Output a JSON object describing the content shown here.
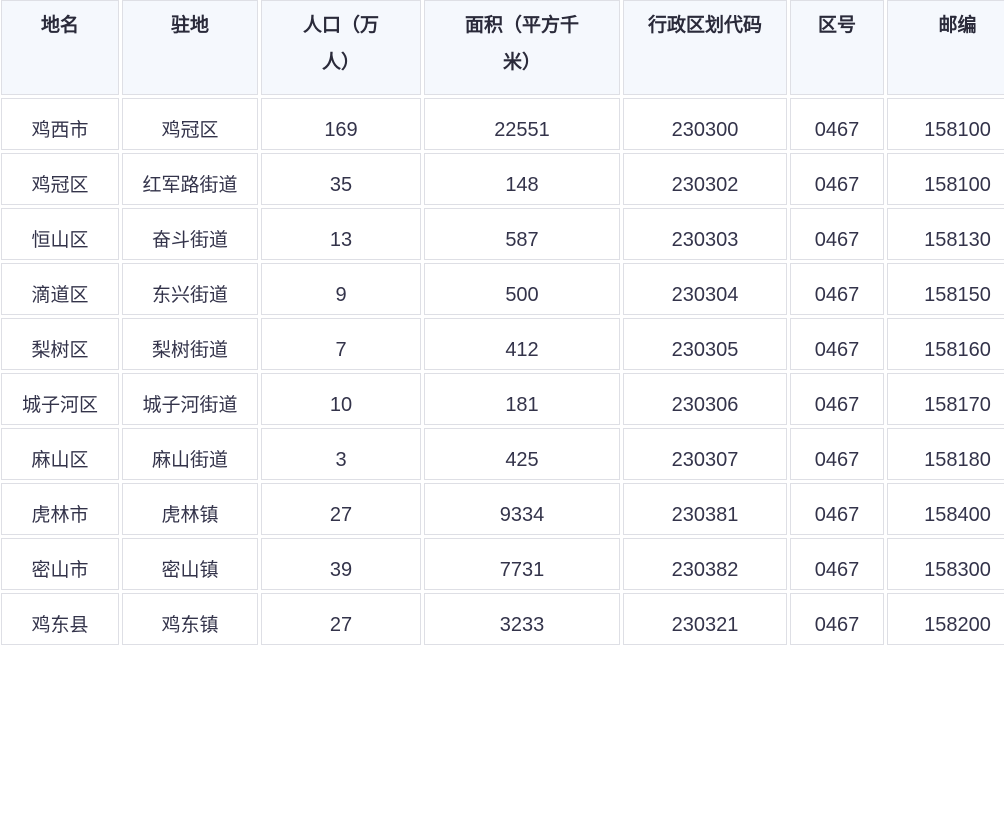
{
  "table": {
    "headers": [
      "地名",
      "驻地",
      "人口（万人）",
      "面积（平方千米）",
      "行政区划代码",
      "区号",
      "邮编"
    ],
    "rows": [
      [
        "鸡西市",
        "鸡冠区",
        "169",
        "22551",
        "230300",
        "0467",
        "158100"
      ],
      [
        "鸡冠区",
        "红军路街道",
        "35",
        "148",
        "230302",
        "0467",
        "158100"
      ],
      [
        "恒山区",
        "奋斗街道",
        "13",
        "587",
        "230303",
        "0467",
        "158130"
      ],
      [
        "滴道区",
        "东兴街道",
        "9",
        "500",
        "230304",
        "0467",
        "158150"
      ],
      [
        "梨树区",
        "梨树街道",
        "7",
        "412",
        "230305",
        "0467",
        "158160"
      ],
      [
        "城子河区",
        "城子河街道",
        "10",
        "181",
        "230306",
        "0467",
        "158170"
      ],
      [
        "麻山区",
        "麻山街道",
        "3",
        "425",
        "230307",
        "0467",
        "158180"
      ],
      [
        "虎林市",
        "虎林镇",
        "27",
        "9334",
        "230381",
        "0467",
        "158400"
      ],
      [
        "密山市",
        "密山镇",
        "39",
        "7731",
        "230382",
        "0467",
        "158300"
      ],
      [
        "鸡东县",
        "鸡东镇",
        "27",
        "3233",
        "230321",
        "0467",
        "158200"
      ]
    ]
  }
}
